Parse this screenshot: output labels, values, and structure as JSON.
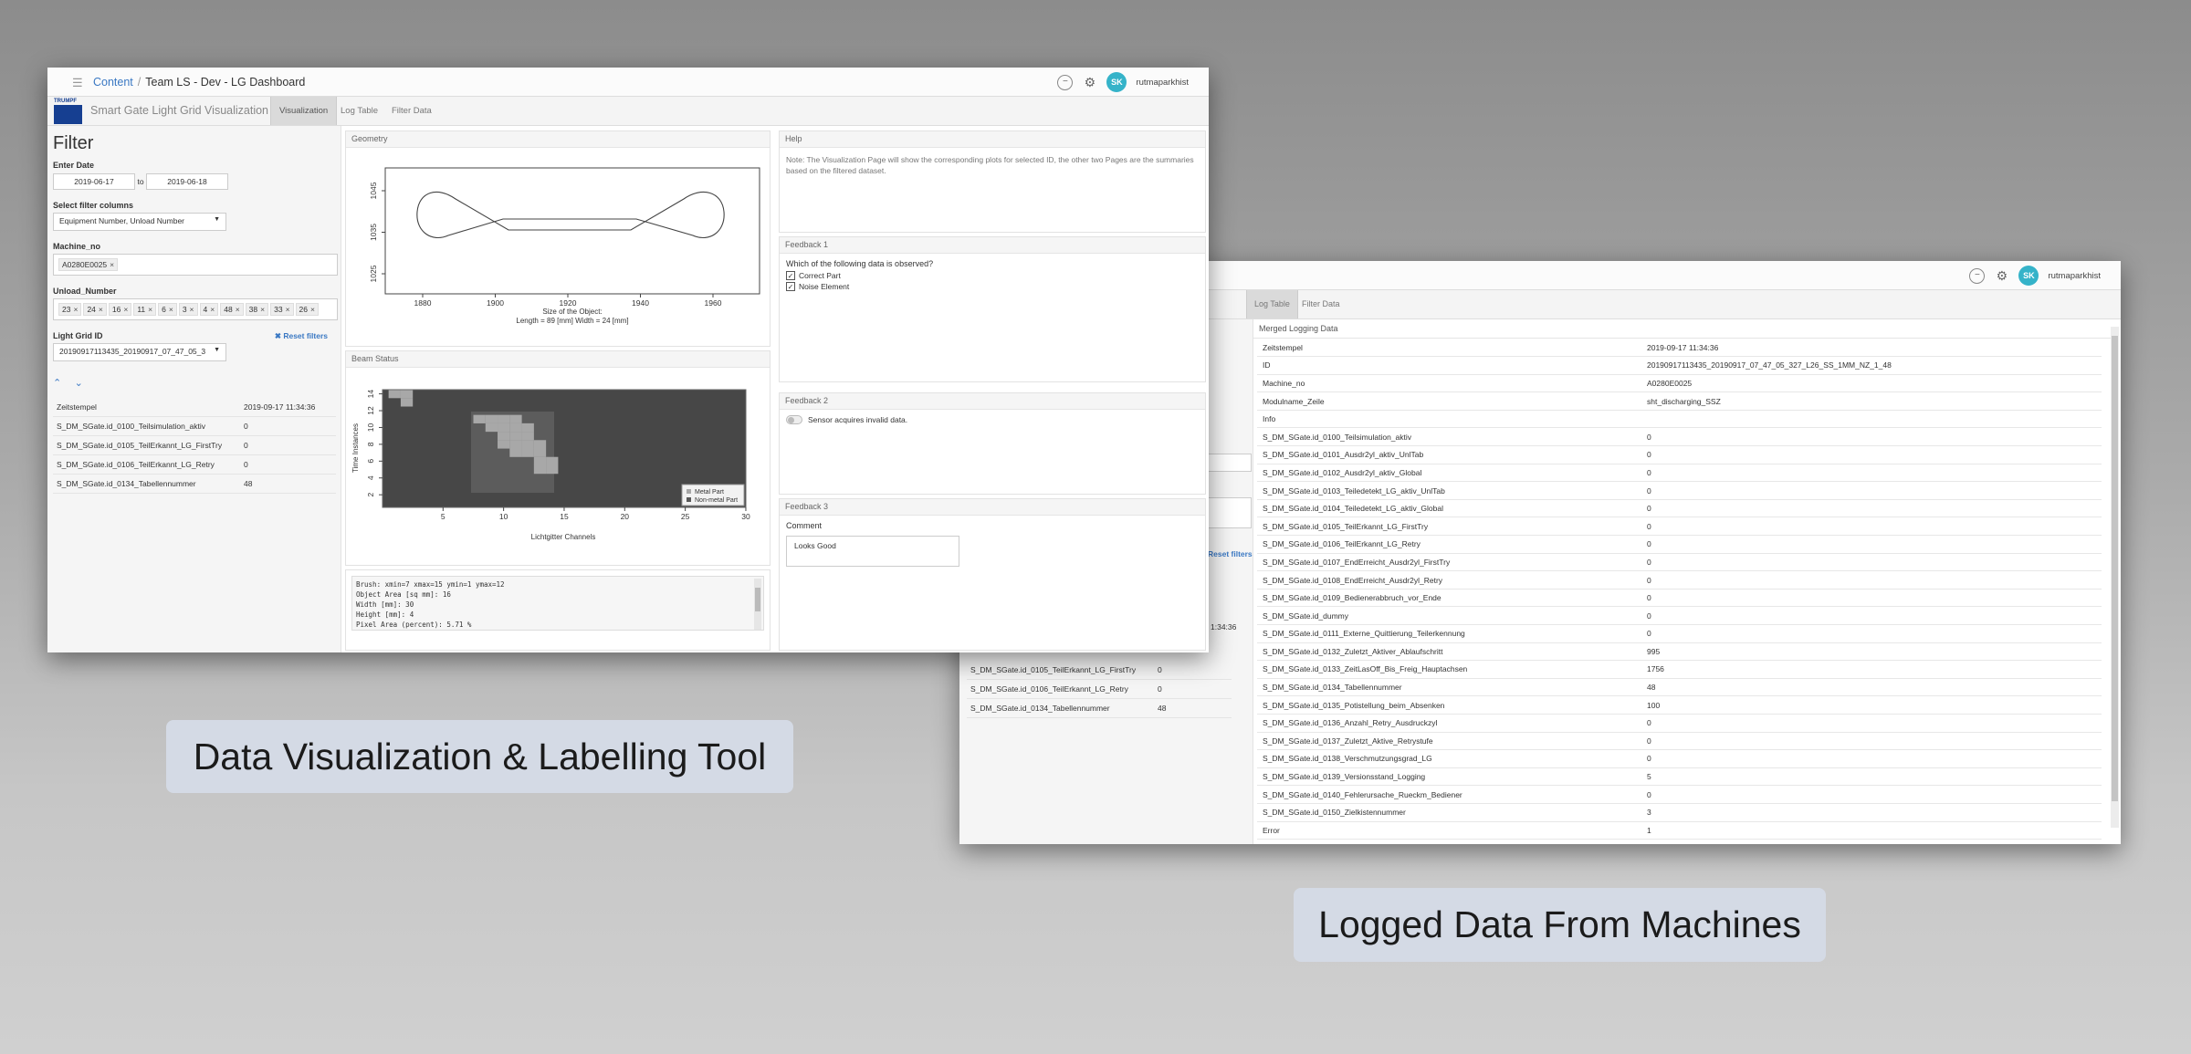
{
  "dashboard": {
    "breadcrumb": {
      "root": "Content",
      "separator": "/",
      "current": "Team LS - Dev - LG Dashboard"
    },
    "user": {
      "initials": "SK",
      "name": "rutmaparkhist"
    },
    "logo_text": "TRUMPF",
    "app_title": "Smart Gate Light Grid Visualization",
    "tabs": [
      "Visualization",
      "Log Table",
      "Filter Data"
    ],
    "active_tab": "Visualization",
    "filter": {
      "heading": "Filter",
      "date_label": "Enter Date",
      "date_from": "2019-06-17",
      "date_to_word": "to",
      "date_to": "2019-06-18",
      "columns_label": "Select filter columns",
      "columns_value": "Equipment Number, Unload Number",
      "machine_label": "Machine_no",
      "machine_tags": [
        "A0280E0025"
      ],
      "unload_label": "Unload_Number",
      "unload_tags": [
        "23",
        "24",
        "16",
        "11",
        "6",
        "3",
        "4",
        "48",
        "38",
        "33",
        "26"
      ],
      "grid_label": "Light Grid ID",
      "grid_value": "20190917113435_20190917_07_47_05_3",
      "reset_label": "Reset filters",
      "summary": [
        {
          "k": "Zeitstempel",
          "v": "2019-09-17 11:34:36"
        },
        {
          "k": "S_DM_SGate.id_0100_Teilsimulation_aktiv",
          "v": "0"
        },
        {
          "k": "S_DM_SGate.id_0105_TeilErkannt_LG_FirstTry",
          "v": "0"
        },
        {
          "k": "S_DM_SGate.id_0106_TeilErkannt_LG_Retry",
          "v": "0"
        },
        {
          "k": "S_DM_SGate.id_0134_Tabellennummer",
          "v": "48"
        }
      ]
    },
    "geometry": {
      "title": "Geometry",
      "xlabel1": "Size of the Object:",
      "xlabel2": "Length = 89 [mm]     Width = 24 [mm]",
      "xticks": [
        "1880",
        "1900",
        "1920",
        "1940",
        "1960"
      ],
      "yticks": [
        "1025",
        "1035",
        "1045"
      ]
    },
    "beam": {
      "title": "Beam Status",
      "ylabel": "Time Instances",
      "xlabel": "Lichtgitter Channels",
      "xticks": [
        "5",
        "10",
        "15",
        "20",
        "25",
        "30"
      ],
      "yticks": [
        "2",
        "4",
        "6",
        "8",
        "10",
        "12",
        "14"
      ],
      "legend": [
        "Metal Part",
        "Non-metal Part"
      ],
      "colors": {
        "background": "#474747",
        "box": "#5c5c5c",
        "metal": "#a8a8a8",
        "nonmetal": "#585858"
      }
    },
    "console_lines": [
      "Brush: xmin=7 xmax=15 ymin=1 ymax=12",
      "Object Area [sq mm]: 16",
      "Width [mm]: 30",
      "Height [mm]: 4",
      "Pixel Area (percent): 5.71 %"
    ],
    "help": {
      "title": "Help",
      "text": "Note: The Visualization Page will show the corresponding plots for selected ID, the other two Pages are the summaries based on the filtered dataset."
    },
    "feedback1": {
      "title": "Feedback 1",
      "question": "Which of the following data is observed?",
      "options": [
        "Correct Part",
        "Noise Element"
      ]
    },
    "feedback2": {
      "title": "Feedback 2",
      "label": "Sensor acquires invalid data."
    },
    "feedback3": {
      "title": "Feedback 3",
      "label": "Comment",
      "value": "Looks Good"
    }
  },
  "logtable": {
    "user": {
      "initials": "SK",
      "name": "rutmaparkhist"
    },
    "tabs": [
      "ization",
      "Log Table",
      "Filter Data"
    ],
    "active_tab": "Log Table",
    "panel_title": "Merged Logging Data",
    "left_fragments": {
      "x_mark": "×",
      "reset": "Reset filters",
      "time": "1:34:36"
    },
    "left_rows": [
      {
        "k": "S_DM_SGate.id_0105_TeilErkannt_LG_FirstTry",
        "v": "0"
      },
      {
        "k": "S_DM_SGate.id_0106_TeilErkannt_LG_Retry",
        "v": "0"
      },
      {
        "k": "S_DM_SGate.id_0134_Tabellennummer",
        "v": "48"
      }
    ],
    "rows": [
      {
        "k": "Zeitstempel",
        "v": "2019-09-17 11:34:36"
      },
      {
        "k": "ID",
        "v": "20190917113435_20190917_07_47_05_327_L26_SS_1MM_NZ_1_48"
      },
      {
        "k": "Machine_no",
        "v": "A0280E0025"
      },
      {
        "k": "Modulname_Zeile",
        "v": "sht_discharging_SSZ"
      },
      {
        "k": "Info",
        "v": ""
      },
      {
        "k": "S_DM_SGate.id_0100_Teilsimulation_aktiv",
        "v": "0"
      },
      {
        "k": "S_DM_SGate.id_0101_Ausdr2yl_aktiv_UnlTab",
        "v": "0"
      },
      {
        "k": "S_DM_SGate.id_0102_Ausdr2yl_aktiv_Global",
        "v": "0"
      },
      {
        "k": "S_DM_SGate.id_0103_Teiledetekt_LG_aktiv_UnlTab",
        "v": "0"
      },
      {
        "k": "S_DM_SGate.id_0104_Teiledetekt_LG_aktiv_Global",
        "v": "0"
      },
      {
        "k": "S_DM_SGate.id_0105_TeilErkannt_LG_FirstTry",
        "v": "0"
      },
      {
        "k": "S_DM_SGate.id_0106_TeilErkannt_LG_Retry",
        "v": "0"
      },
      {
        "k": "S_DM_SGate.id_0107_EndErreicht_Ausdr2yl_FirstTry",
        "v": "0"
      },
      {
        "k": "S_DM_SGate.id_0108_EndErreicht_Ausdr2yl_Retry",
        "v": "0"
      },
      {
        "k": "S_DM_SGate.id_0109_Bedienerabbruch_vor_Ende",
        "v": "0"
      },
      {
        "k": "S_DM_SGate.id_dummy",
        "v": "0"
      },
      {
        "k": "S_DM_SGate.id_0111_Externe_Quittierung_Teilerkennung",
        "v": "0"
      },
      {
        "k": "S_DM_SGate.id_0132_Zuletzt_Aktiver_Ablaufschritt",
        "v": "995"
      },
      {
        "k": "S_DM_SGate.id_0133_ZeitLasOff_Bis_Freig_Hauptachsen",
        "v": "1756"
      },
      {
        "k": "S_DM_SGate.id_0134_Tabellennummer",
        "v": "48"
      },
      {
        "k": "S_DM_SGate.id_0135_Potistellung_beim_Absenken",
        "v": "100"
      },
      {
        "k": "S_DM_SGate.id_0136_Anzahl_Retry_Ausdruckzyl",
        "v": "0"
      },
      {
        "k": "S_DM_SGate.id_0137_Zuletzt_Aktive_Retrystufe",
        "v": "0"
      },
      {
        "k": "S_DM_SGate.id_0138_Verschmutzungsgrad_LG",
        "v": "0"
      },
      {
        "k": "S_DM_SGate.id_0139_Versionsstand_Logging",
        "v": "5"
      },
      {
        "k": "S_DM_SGate.id_0140_Fehlerursache_Rueckm_Bediener",
        "v": "0"
      },
      {
        "k": "S_DM_SGate.id_0150_Zielkistennummer",
        "v": "3"
      },
      {
        "k": "Error",
        "v": "1"
      }
    ]
  },
  "captions": {
    "left": "Data Visualization & Labelling Tool",
    "right": "Logged Data From Machines"
  }
}
